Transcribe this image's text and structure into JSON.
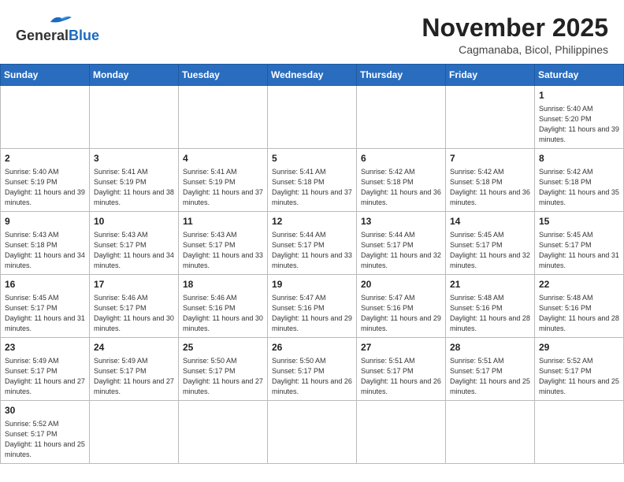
{
  "header": {
    "logo_general": "General",
    "logo_blue": "Blue",
    "month_title": "November 2025",
    "location": "Cagmanaba, Bicol, Philippines"
  },
  "weekdays": [
    "Sunday",
    "Monday",
    "Tuesday",
    "Wednesday",
    "Thursday",
    "Friday",
    "Saturday"
  ],
  "days": {
    "1": {
      "sunrise": "5:40 AM",
      "sunset": "5:20 PM",
      "daylight": "11 hours and 39 minutes."
    },
    "2": {
      "sunrise": "5:40 AM",
      "sunset": "5:19 PM",
      "daylight": "11 hours and 39 minutes."
    },
    "3": {
      "sunrise": "5:41 AM",
      "sunset": "5:19 PM",
      "daylight": "11 hours and 38 minutes."
    },
    "4": {
      "sunrise": "5:41 AM",
      "sunset": "5:19 PM",
      "daylight": "11 hours and 37 minutes."
    },
    "5": {
      "sunrise": "5:41 AM",
      "sunset": "5:18 PM",
      "daylight": "11 hours and 37 minutes."
    },
    "6": {
      "sunrise": "5:42 AM",
      "sunset": "5:18 PM",
      "daylight": "11 hours and 36 minutes."
    },
    "7": {
      "sunrise": "5:42 AM",
      "sunset": "5:18 PM",
      "daylight": "11 hours and 36 minutes."
    },
    "8": {
      "sunrise": "5:42 AM",
      "sunset": "5:18 PM",
      "daylight": "11 hours and 35 minutes."
    },
    "9": {
      "sunrise": "5:43 AM",
      "sunset": "5:18 PM",
      "daylight": "11 hours and 34 minutes."
    },
    "10": {
      "sunrise": "5:43 AM",
      "sunset": "5:17 PM",
      "daylight": "11 hours and 34 minutes."
    },
    "11": {
      "sunrise": "5:43 AM",
      "sunset": "5:17 PM",
      "daylight": "11 hours and 33 minutes."
    },
    "12": {
      "sunrise": "5:44 AM",
      "sunset": "5:17 PM",
      "daylight": "11 hours and 33 minutes."
    },
    "13": {
      "sunrise": "5:44 AM",
      "sunset": "5:17 PM",
      "daylight": "11 hours and 32 minutes."
    },
    "14": {
      "sunrise": "5:45 AM",
      "sunset": "5:17 PM",
      "daylight": "11 hours and 32 minutes."
    },
    "15": {
      "sunrise": "5:45 AM",
      "sunset": "5:17 PM",
      "daylight": "11 hours and 31 minutes."
    },
    "16": {
      "sunrise": "5:45 AM",
      "sunset": "5:17 PM",
      "daylight": "11 hours and 31 minutes."
    },
    "17": {
      "sunrise": "5:46 AM",
      "sunset": "5:17 PM",
      "daylight": "11 hours and 30 minutes."
    },
    "18": {
      "sunrise": "5:46 AM",
      "sunset": "5:16 PM",
      "daylight": "11 hours and 30 minutes."
    },
    "19": {
      "sunrise": "5:47 AM",
      "sunset": "5:16 PM",
      "daylight": "11 hours and 29 minutes."
    },
    "20": {
      "sunrise": "5:47 AM",
      "sunset": "5:16 PM",
      "daylight": "11 hours and 29 minutes."
    },
    "21": {
      "sunrise": "5:48 AM",
      "sunset": "5:16 PM",
      "daylight": "11 hours and 28 minutes."
    },
    "22": {
      "sunrise": "5:48 AM",
      "sunset": "5:16 PM",
      "daylight": "11 hours and 28 minutes."
    },
    "23": {
      "sunrise": "5:49 AM",
      "sunset": "5:17 PM",
      "daylight": "11 hours and 27 minutes."
    },
    "24": {
      "sunrise": "5:49 AM",
      "sunset": "5:17 PM",
      "daylight": "11 hours and 27 minutes."
    },
    "25": {
      "sunrise": "5:50 AM",
      "sunset": "5:17 PM",
      "daylight": "11 hours and 27 minutes."
    },
    "26": {
      "sunrise": "5:50 AM",
      "sunset": "5:17 PM",
      "daylight": "11 hours and 26 minutes."
    },
    "27": {
      "sunrise": "5:51 AM",
      "sunset": "5:17 PM",
      "daylight": "11 hours and 26 minutes."
    },
    "28": {
      "sunrise": "5:51 AM",
      "sunset": "5:17 PM",
      "daylight": "11 hours and 25 minutes."
    },
    "29": {
      "sunrise": "5:52 AM",
      "sunset": "5:17 PM",
      "daylight": "11 hours and 25 minutes."
    },
    "30": {
      "sunrise": "5:52 AM",
      "sunset": "5:17 PM",
      "daylight": "11 hours and 25 minutes."
    }
  }
}
